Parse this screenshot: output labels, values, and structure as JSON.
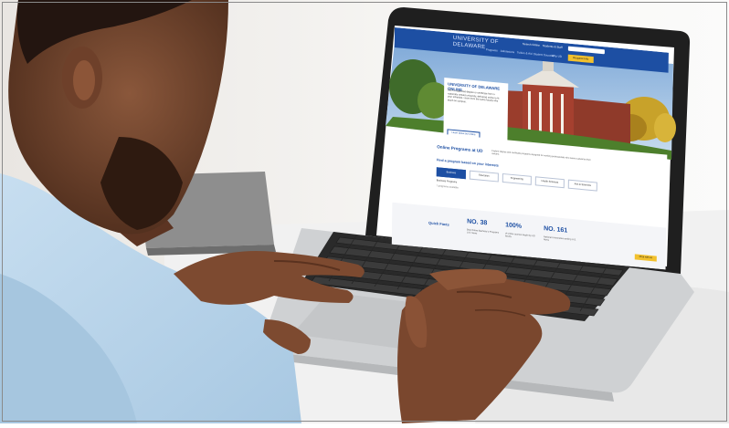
{
  "colors": {
    "brand_blue": "#1d4fa3",
    "accent_gold": "#f2c12e",
    "wall": "#f3f2f0",
    "skin": "#7a4a32",
    "shirt": "#b8d5ea"
  },
  "site": {
    "logo_line1": "UNIVERSITY OF",
    "logo_line2": "DELAWARE",
    "util_links": [
      "Search Online",
      "Students & Staff",
      "Contact"
    ],
    "nav_links": [
      "Programs",
      "Admissions",
      "Tuition & Aid",
      "Student Success",
      "Why UD",
      "About"
    ],
    "apply_label": "Request Info",
    "hero_title": "UNIVERSITY OF DELAWARE ONLINE",
    "hero_body": "Earn a respected degree or certificate from a nationally ranked university, delivered online to fit your schedule. Learn from the same faculty who teach on campus.",
    "hero_button": "Learn about our online",
    "programs_title": "Online Programs at UD",
    "programs_text": "Explore degree and certificate programs designed for working professionals who want to advance their careers.",
    "interest_heading": "Find a program based on your interests",
    "pills": [
      "Business",
      "Education",
      "Engineering",
      "Health Sciences",
      "Arts & Sciences"
    ],
    "sub1": "Business Programs",
    "sub2": "7 programs available",
    "facts_heading": "Quick Facts",
    "stats": [
      {
        "value": "NO. 38",
        "caption": "Best Online Bachelor's Programs U.S. News"
      },
      {
        "value": "100%",
        "caption": "of online courses taught by UD faculty"
      },
      {
        "value": "NO. 161",
        "caption": "National Universities ranking U.S. News"
      }
    ],
    "chat_label": "Chat with us"
  }
}
